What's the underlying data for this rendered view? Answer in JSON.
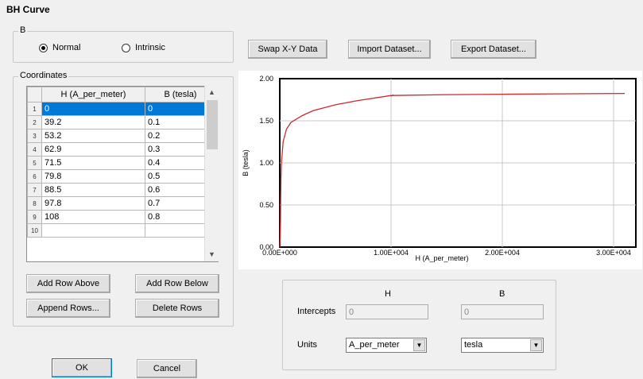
{
  "window_title": "BH Curve",
  "b_group": {
    "legend": "B",
    "normal_label": "Normal",
    "intrinsic_label": "Intrinsic",
    "selected": "Normal"
  },
  "coords_group": {
    "legend": "Coordinates"
  },
  "table": {
    "headers": [
      "H (A_per_meter)",
      "B (tesla)"
    ],
    "rows": [
      {
        "n": "1",
        "h": "0",
        "b": "0"
      },
      {
        "n": "2",
        "h": "39.2",
        "b": "0.1"
      },
      {
        "n": "3",
        "h": "53.2",
        "b": "0.2"
      },
      {
        "n": "4",
        "h": "62.9",
        "b": "0.3"
      },
      {
        "n": "5",
        "h": "71.5",
        "b": "0.4"
      },
      {
        "n": "6",
        "h": "79.8",
        "b": "0.5"
      },
      {
        "n": "7",
        "h": "88.5",
        "b": "0.6"
      },
      {
        "n": "8",
        "h": "97.8",
        "b": "0.7"
      },
      {
        "n": "9",
        "h": "108",
        "b": "0.8"
      },
      {
        "n": "10",
        "h": "",
        "b": ""
      }
    ]
  },
  "buttons": {
    "add_row_above": "Add Row Above",
    "add_row_below": "Add Row Below",
    "append_rows": "Append Rows...",
    "delete_rows": "Delete Rows",
    "swap_xy": "Swap X-Y Data",
    "import_dataset": "Import Dataset...",
    "export_dataset": "Export Dataset...",
    "ok": "OK",
    "cancel": "Cancel"
  },
  "bottom_panel": {
    "h_header": "H",
    "b_header": "B",
    "intercepts_label": "Intercepts",
    "h_intercept": "0",
    "b_intercept": "0",
    "units_label": "Units",
    "h_unit": "A_per_meter",
    "b_unit": "tesla"
  },
  "chart_data": {
    "type": "line",
    "xlabel": "H (A_per_meter)",
    "ylabel": "B (tesla)",
    "xlim": [
      0,
      32000
    ],
    "ylim": [
      0,
      2.0
    ],
    "x_tick_labels": [
      "0.00E+000",
      "1.00E+004",
      "2.00E+004",
      "3.00E+004"
    ],
    "y_tick_labels": [
      "0.00",
      "0.50",
      "1.00",
      "1.50",
      "2.00"
    ],
    "x_ticks": [
      0,
      10000,
      20000,
      30000
    ],
    "y_ticks": [
      0,
      0.5,
      1.0,
      1.5,
      2.0
    ],
    "grid": true,
    "series": [
      {
        "color": "#d0282e",
        "x": [
          0,
          39.2,
          53.2,
          62.9,
          71.5,
          79.8,
          88.5,
          97.8,
          108,
          150,
          300,
          600,
          1000,
          2000,
          3000,
          5000,
          7000,
          10000,
          15000,
          20000,
          25000,
          31000
        ],
        "y": [
          0,
          0.1,
          0.2,
          0.3,
          0.4,
          0.5,
          0.6,
          0.7,
          0.8,
          1.0,
          1.25,
          1.4,
          1.48,
          1.56,
          1.62,
          1.69,
          1.74,
          1.8,
          1.81,
          1.815,
          1.82,
          1.825
        ]
      }
    ]
  }
}
